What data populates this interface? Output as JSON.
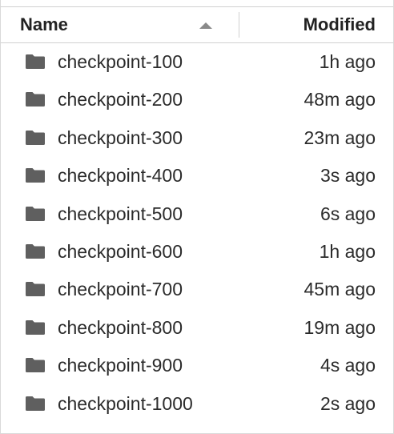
{
  "header": {
    "name_label": "Name",
    "modified_label": "Modified",
    "sort_icon": "sort-ascending-icon"
  },
  "colors": {
    "folder_icon": "#5f5f5f",
    "text": "#2b2b2b",
    "border": "#d0d0d0"
  },
  "files": [
    {
      "name": "checkpoint-100",
      "modified": "1h ago",
      "icon": "folder-icon"
    },
    {
      "name": "checkpoint-200",
      "modified": "48m ago",
      "icon": "folder-icon"
    },
    {
      "name": "checkpoint-300",
      "modified": "23m ago",
      "icon": "folder-icon"
    },
    {
      "name": "checkpoint-400",
      "modified": "3s ago",
      "icon": "folder-icon"
    },
    {
      "name": "checkpoint-500",
      "modified": "6s ago",
      "icon": "folder-icon"
    },
    {
      "name": "checkpoint-600",
      "modified": "1h ago",
      "icon": "folder-icon"
    },
    {
      "name": "checkpoint-700",
      "modified": "45m ago",
      "icon": "folder-icon"
    },
    {
      "name": "checkpoint-800",
      "modified": "19m ago",
      "icon": "folder-icon"
    },
    {
      "name": "checkpoint-900",
      "modified": "4s ago",
      "icon": "folder-icon"
    },
    {
      "name": "checkpoint-1000",
      "modified": "2s ago",
      "icon": "folder-icon"
    }
  ]
}
